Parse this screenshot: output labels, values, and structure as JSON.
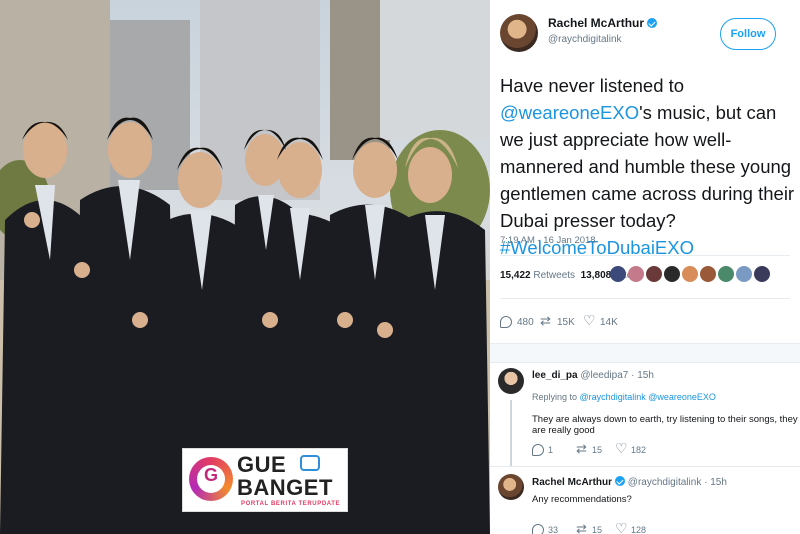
{
  "logo": {
    "letter": "G",
    "line1": "GUE",
    "line2": "BANGET",
    "tagline": "PORTAL BERITA TERUPDATE"
  },
  "tweet": {
    "author_name": "Rachel McArthur",
    "author_handle": "@raychdigitalink",
    "follow_label": "Follow",
    "text_part1": "Have never listened to ",
    "mention": "@weareoneEXO",
    "text_part2": "'s music, but can we just appreciate how well-mannered and humble these young gentlemen came across during their Dubai presser today? ",
    "hashtag": "#WelcomeToDubaiEXO",
    "timestamp": "7:19 AM - 16 Jan 2018",
    "retweets_count": "15,422",
    "retweets_label": "Retweets",
    "likes_count": "13,808",
    "likes_label": "Likes",
    "replies": "480",
    "retweets_short": "15K",
    "likes_short": "14K"
  },
  "reply1": {
    "name": "lee_di_pa",
    "handle_time": "@leedipa7 · 15h",
    "replying_prefix": "Replying to",
    "replying_to": "@raychdigitalink @weareoneEXO",
    "text": "They are always down to earth, try listening to their songs, they are really good",
    "replies": "1",
    "retweets": "15",
    "likes": "182"
  },
  "reply2": {
    "name": "Rachel McArthur",
    "handle_time": "@raychdigitalink · 15h",
    "text": "Any recommendations?",
    "replies": "33",
    "retweets": "15",
    "likes": "128"
  },
  "colors": {
    "twitter_blue": "#1da1f2",
    "link_blue": "#1b95e0",
    "muted": "#657786"
  }
}
